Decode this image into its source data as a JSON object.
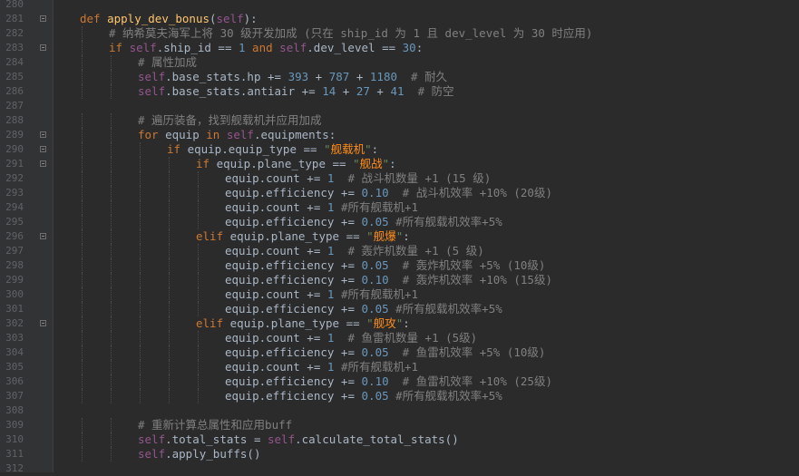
{
  "colors": {
    "background": "#2b2b2b",
    "gutter": "#313335",
    "line_number": "#606366",
    "keyword": "#cc7832",
    "function_name": "#ffc66d",
    "self": "#94558d",
    "number": "#6897bb",
    "comment": "#808080",
    "identifier": "#a9b7c6",
    "chinese_string": "#ff8c1a"
  },
  "lines": [
    {
      "num": "280",
      "indent": 0,
      "fold": false,
      "tokens": []
    },
    {
      "num": "281",
      "indent": 0,
      "fold": true,
      "tokens": [
        {
          "t": "def ",
          "c": "kw"
        },
        {
          "t": "apply_dev_bonus",
          "c": "fn"
        },
        {
          "t": "(",
          "c": "op"
        },
        {
          "t": "self",
          "c": "self"
        },
        {
          "t": "):",
          "c": "op"
        }
      ]
    },
    {
      "num": "282",
      "indent": 1,
      "fold": false,
      "tokens": [
        {
          "t": "# 纳希莫夫海军上将 30 级开发加成 (只在 ship_id 为 1 且 dev_level 为 30 时应用)",
          "c": "cm"
        }
      ]
    },
    {
      "num": "283",
      "indent": 1,
      "fold": true,
      "tokens": [
        {
          "t": "if ",
          "c": "kw"
        },
        {
          "t": "self",
          "c": "self"
        },
        {
          "t": ".ship_id == ",
          "c": "id"
        },
        {
          "t": "1",
          "c": "num"
        },
        {
          "t": " and ",
          "c": "kw"
        },
        {
          "t": "self",
          "c": "self"
        },
        {
          "t": ".dev_level == ",
          "c": "id"
        },
        {
          "t": "30",
          "c": "num"
        },
        {
          "t": ":",
          "c": "op"
        }
      ]
    },
    {
      "num": "284",
      "indent": 2,
      "fold": false,
      "tokens": [
        {
          "t": "# 属性加成",
          "c": "cm"
        }
      ]
    },
    {
      "num": "285",
      "indent": 2,
      "fold": false,
      "tokens": [
        {
          "t": "self",
          "c": "self"
        },
        {
          "t": ".base_stats.hp += ",
          "c": "id"
        },
        {
          "t": "393",
          "c": "num"
        },
        {
          "t": " + ",
          "c": "op"
        },
        {
          "t": "787",
          "c": "num"
        },
        {
          "t": " + ",
          "c": "op"
        },
        {
          "t": "1180",
          "c": "num"
        },
        {
          "t": "  # 耐久",
          "c": "cm"
        }
      ]
    },
    {
      "num": "286",
      "indent": 2,
      "fold": false,
      "tokens": [
        {
          "t": "self",
          "c": "self"
        },
        {
          "t": ".base_stats.antiair += ",
          "c": "id"
        },
        {
          "t": "14",
          "c": "num"
        },
        {
          "t": " + ",
          "c": "op"
        },
        {
          "t": "27",
          "c": "num"
        },
        {
          "t": " + ",
          "c": "op"
        },
        {
          "t": "41",
          "c": "num"
        },
        {
          "t": "  # 防空",
          "c": "cm"
        }
      ]
    },
    {
      "num": "287",
      "indent": 2,
      "fold": false,
      "tokens": []
    },
    {
      "num": "288",
      "indent": 2,
      "fold": false,
      "tokens": [
        {
          "t": "# 遍历装备，找到舰载机并应用加成",
          "c": "cm"
        }
      ]
    },
    {
      "num": "289",
      "indent": 2,
      "fold": true,
      "tokens": [
        {
          "t": "for ",
          "c": "kw"
        },
        {
          "t": "equip ",
          "c": "id"
        },
        {
          "t": "in ",
          "c": "kw"
        },
        {
          "t": "self",
          "c": "self"
        },
        {
          "t": ".equipments:",
          "c": "id"
        }
      ]
    },
    {
      "num": "290",
      "indent": 3,
      "fold": true,
      "tokens": [
        {
          "t": "if ",
          "c": "kw"
        },
        {
          "t": "equip.equip_type == ",
          "c": "id"
        },
        {
          "t": "\"",
          "c": "str"
        },
        {
          "t": "舰载机",
          "c": "strz"
        },
        {
          "t": "\"",
          "c": "str"
        },
        {
          "t": ":",
          "c": "op"
        }
      ]
    },
    {
      "num": "291",
      "indent": 4,
      "fold": true,
      "tokens": [
        {
          "t": "if ",
          "c": "kw"
        },
        {
          "t": "equip.plane_type == ",
          "c": "id"
        },
        {
          "t": "\"",
          "c": "str"
        },
        {
          "t": "舰战",
          "c": "strz"
        },
        {
          "t": "\"",
          "c": "str"
        },
        {
          "t": ":",
          "c": "op"
        }
      ]
    },
    {
      "num": "292",
      "indent": 5,
      "fold": false,
      "tokens": [
        {
          "t": "equip.count += ",
          "c": "id"
        },
        {
          "t": "1",
          "c": "num"
        },
        {
          "t": "  # 战斗机数量 +1 (15 级)",
          "c": "cm"
        }
      ]
    },
    {
      "num": "293",
      "indent": 5,
      "fold": false,
      "tokens": [
        {
          "t": "equip.efficiency += ",
          "c": "id"
        },
        {
          "t": "0.10",
          "c": "num"
        },
        {
          "t": "  # 战斗机效率 +10% (20级)",
          "c": "cm"
        }
      ]
    },
    {
      "num": "294",
      "indent": 5,
      "fold": false,
      "tokens": [
        {
          "t": "equip.count += ",
          "c": "id"
        },
        {
          "t": "1",
          "c": "num"
        },
        {
          "t": " #所有舰载机+1",
          "c": "cm"
        }
      ]
    },
    {
      "num": "295",
      "indent": 5,
      "fold": false,
      "tokens": [
        {
          "t": "equip.efficiency += ",
          "c": "id"
        },
        {
          "t": "0.05",
          "c": "num"
        },
        {
          "t": " #所有舰载机效率+5%",
          "c": "cm"
        }
      ]
    },
    {
      "num": "296",
      "indent": 4,
      "fold": true,
      "tokens": [
        {
          "t": "elif ",
          "c": "kw"
        },
        {
          "t": "equip.plane_type == ",
          "c": "id"
        },
        {
          "t": "\"",
          "c": "str"
        },
        {
          "t": "舰爆",
          "c": "strz"
        },
        {
          "t": "\"",
          "c": "str"
        },
        {
          "t": ":",
          "c": "op"
        }
      ]
    },
    {
      "num": "297",
      "indent": 5,
      "fold": false,
      "tokens": [
        {
          "t": "equip.count += ",
          "c": "id"
        },
        {
          "t": "1",
          "c": "num"
        },
        {
          "t": "  # 轰炸机数量 +1 (5 级)",
          "c": "cm"
        }
      ]
    },
    {
      "num": "298",
      "indent": 5,
      "fold": false,
      "tokens": [
        {
          "t": "equip.efficiency += ",
          "c": "id"
        },
        {
          "t": "0.05",
          "c": "num"
        },
        {
          "t": "  # 轰炸机效率 +5% (10级)",
          "c": "cm"
        }
      ]
    },
    {
      "num": "299",
      "indent": 5,
      "fold": false,
      "tokens": [
        {
          "t": "equip.efficiency += ",
          "c": "id"
        },
        {
          "t": "0.10",
          "c": "num"
        },
        {
          "t": "  # 轰炸机效率 +10% (15级)",
          "c": "cm"
        }
      ]
    },
    {
      "num": "300",
      "indent": 5,
      "fold": false,
      "tokens": [
        {
          "t": "equip.count += ",
          "c": "id"
        },
        {
          "t": "1",
          "c": "num"
        },
        {
          "t": " #所有舰载机+1",
          "c": "cm"
        }
      ]
    },
    {
      "num": "301",
      "indent": 5,
      "fold": false,
      "tokens": [
        {
          "t": "equip.efficiency += ",
          "c": "id"
        },
        {
          "t": "0.05",
          "c": "num"
        },
        {
          "t": " #所有舰载机效率+5%",
          "c": "cm"
        }
      ]
    },
    {
      "num": "302",
      "indent": 4,
      "fold": true,
      "tokens": [
        {
          "t": "elif ",
          "c": "kw"
        },
        {
          "t": "equip.plane_type == ",
          "c": "id"
        },
        {
          "t": "\"",
          "c": "str"
        },
        {
          "t": "舰攻",
          "c": "strz"
        },
        {
          "t": "\"",
          "c": "str"
        },
        {
          "t": ":",
          "c": "op"
        }
      ]
    },
    {
      "num": "303",
      "indent": 5,
      "fold": false,
      "tokens": [
        {
          "t": "equip.count += ",
          "c": "id"
        },
        {
          "t": "1",
          "c": "num"
        },
        {
          "t": "  # 鱼雷机数量 +1 (5级)",
          "c": "cm"
        }
      ]
    },
    {
      "num": "304",
      "indent": 5,
      "fold": false,
      "tokens": [
        {
          "t": "equip.efficiency += ",
          "c": "id"
        },
        {
          "t": "0.05",
          "c": "num"
        },
        {
          "t": "  # 鱼雷机效率 +5% (10级)",
          "c": "cm"
        }
      ]
    },
    {
      "num": "305",
      "indent": 5,
      "fold": false,
      "tokens": [
        {
          "t": "equip.count += ",
          "c": "id"
        },
        {
          "t": "1",
          "c": "num"
        },
        {
          "t": " #所有舰载机+1",
          "c": "cm"
        }
      ]
    },
    {
      "num": "306",
      "indent": 5,
      "fold": false,
      "tokens": [
        {
          "t": "equip.efficiency += ",
          "c": "id"
        },
        {
          "t": "0.10",
          "c": "num"
        },
        {
          "t": "  # 鱼雷机效率 +10% (25级)",
          "c": "cm"
        }
      ]
    },
    {
      "num": "307",
      "indent": 5,
      "fold": false,
      "tokens": [
        {
          "t": "equip.efficiency += ",
          "c": "id"
        },
        {
          "t": "0.05",
          "c": "num"
        },
        {
          "t": " #所有舰载机效率+5%",
          "c": "cm"
        }
      ]
    },
    {
      "num": "308",
      "indent": 2,
      "fold": false,
      "tokens": []
    },
    {
      "num": "309",
      "indent": 2,
      "fold": false,
      "tokens": [
        {
          "t": "# 重新计算总属性和应用buff",
          "c": "cm"
        }
      ]
    },
    {
      "num": "310",
      "indent": 2,
      "fold": false,
      "tokens": [
        {
          "t": "self",
          "c": "self"
        },
        {
          "t": ".total_stats = ",
          "c": "id"
        },
        {
          "t": "self",
          "c": "self"
        },
        {
          "t": ".calculate_total_stats()",
          "c": "id"
        }
      ]
    },
    {
      "num": "311",
      "indent": 2,
      "fold": false,
      "tokens": [
        {
          "t": "self",
          "c": "self"
        },
        {
          "t": ".apply_buffs()",
          "c": "id"
        }
      ]
    },
    {
      "num": "312",
      "indent": 0,
      "fold": false,
      "tokens": []
    }
  ]
}
